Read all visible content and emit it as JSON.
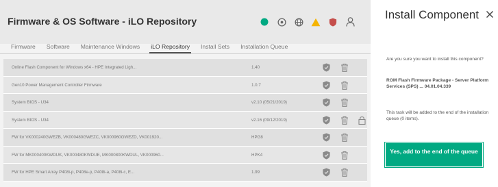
{
  "header": {
    "title": "Firmware & OS Software - iLO Repository",
    "status_icons": [
      {
        "name": "health-icon",
        "color": "#01a982"
      },
      {
        "name": "uid-icon",
        "color": "#666666"
      },
      {
        "name": "globe-icon",
        "color": "#666666"
      },
      {
        "name": "warning-icon",
        "color": "#f5b400"
      },
      {
        "name": "security-shield-icon",
        "color": "#c54e4b"
      },
      {
        "name": "user-icon",
        "color": "#666666"
      }
    ]
  },
  "tabs": [
    {
      "label": "Firmware",
      "active": false
    },
    {
      "label": "Software",
      "active": false
    },
    {
      "label": "Maintenance Windows",
      "active": false
    },
    {
      "label": "iLO Repository",
      "active": true
    },
    {
      "label": "Install Sets",
      "active": false
    },
    {
      "label": "Installation Queue",
      "active": false
    }
  ],
  "repository_rows": [
    {
      "name": "Online Flash Component for Windows x64 - HPE Integrated Ligh...",
      "version": "1.40",
      "locked": false
    },
    {
      "name": "Gen10 Power Management Controller Firmware",
      "version": "1.0.7",
      "locked": false
    },
    {
      "name": "System BIOS - U34",
      "version": "v2.10 (05/21/2019)",
      "locked": false
    },
    {
      "name": "System BIOS - U34",
      "version": "v2.16 (09/12/2019)",
      "locked": true
    },
    {
      "name": "FW for VK000240GWEZB, VK000480GWEZC, VK000960GWEZD, VK001920...",
      "version": "HPG8",
      "locked": false
    },
    {
      "name": "FW for MK000400KWDUK, VK000480KWDUE, MK000800KWDUL, VK000960...",
      "version": "HPK4",
      "locked": false
    },
    {
      "name": "FW for HPE Smart Array P408i-p, P408e-p, P408i-a, P408i-c, E...",
      "version": "1.99",
      "locked": false
    }
  ],
  "install_panel": {
    "title": "Install Component",
    "close_label": "×",
    "confirm_question": "Are you sure you want to install this component?",
    "component_name": "ROM Flash Firmware Package - Server Platform Services (SPS) ... 04.01.04.339",
    "queue_note": "This task will be added to the end of the installation queue (0 items).",
    "confirm_button": "Yes, add to the end of the queue",
    "accent_color": "#01a982"
  }
}
